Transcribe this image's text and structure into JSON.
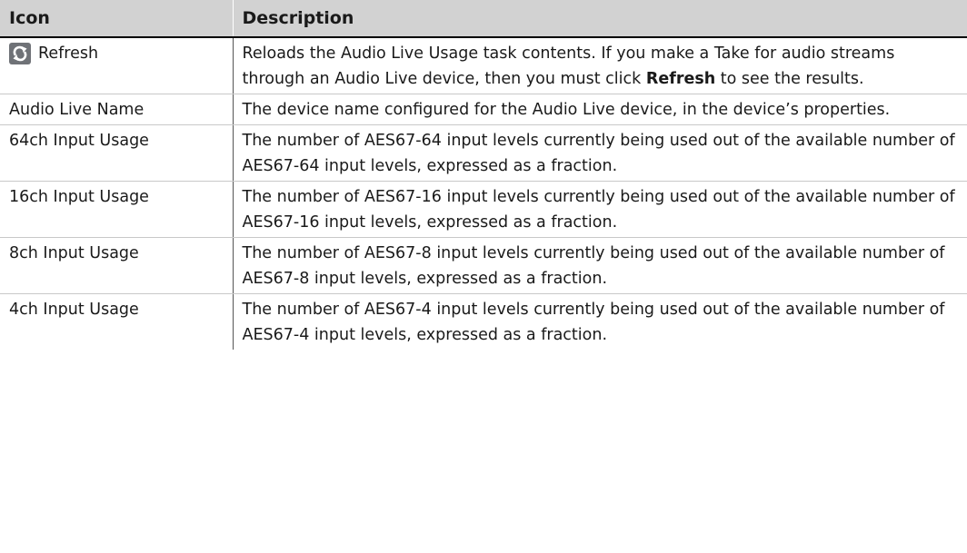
{
  "table": {
    "headers": {
      "icon": "Icon",
      "description": "Description"
    },
    "rows": [
      {
        "icon_name": "refresh-icon",
        "label": "Refresh",
        "desc_pre": "Reloads the Audio Live Usage task contents. If you make a Take for audio streams through an Audio Live device, then you must click ",
        "desc_bold": "Refresh",
        "desc_post": " to see the results."
      },
      {
        "label": "Audio Live Name",
        "desc": "The device name configured for the Audio Live device, in the device’s properties."
      },
      {
        "label": "64ch Input Usage",
        "desc": "The number of AES67-64 input levels currently being used out of the available number of AES67-64 input levels, expressed as a fraction."
      },
      {
        "label": "16ch Input Usage",
        "desc": "The number of AES67-16 input levels currently being used out of the available number of AES67-16 input levels, expressed as a fraction."
      },
      {
        "label": "8ch Input Usage",
        "desc": "The number of AES67-8 input levels currently being used out of the available number of AES67-8 input levels, expressed as a fraction."
      },
      {
        "label": "4ch Input Usage",
        "desc": "The number of AES67-4 input levels currently being used out of the available number of AES67-4 input levels, expressed as a fraction."
      }
    ]
  },
  "colors": {
    "header_bg": "#d2d2d2",
    "icon_bg": "#6f7277",
    "icon_fg": "#ffffff"
  }
}
